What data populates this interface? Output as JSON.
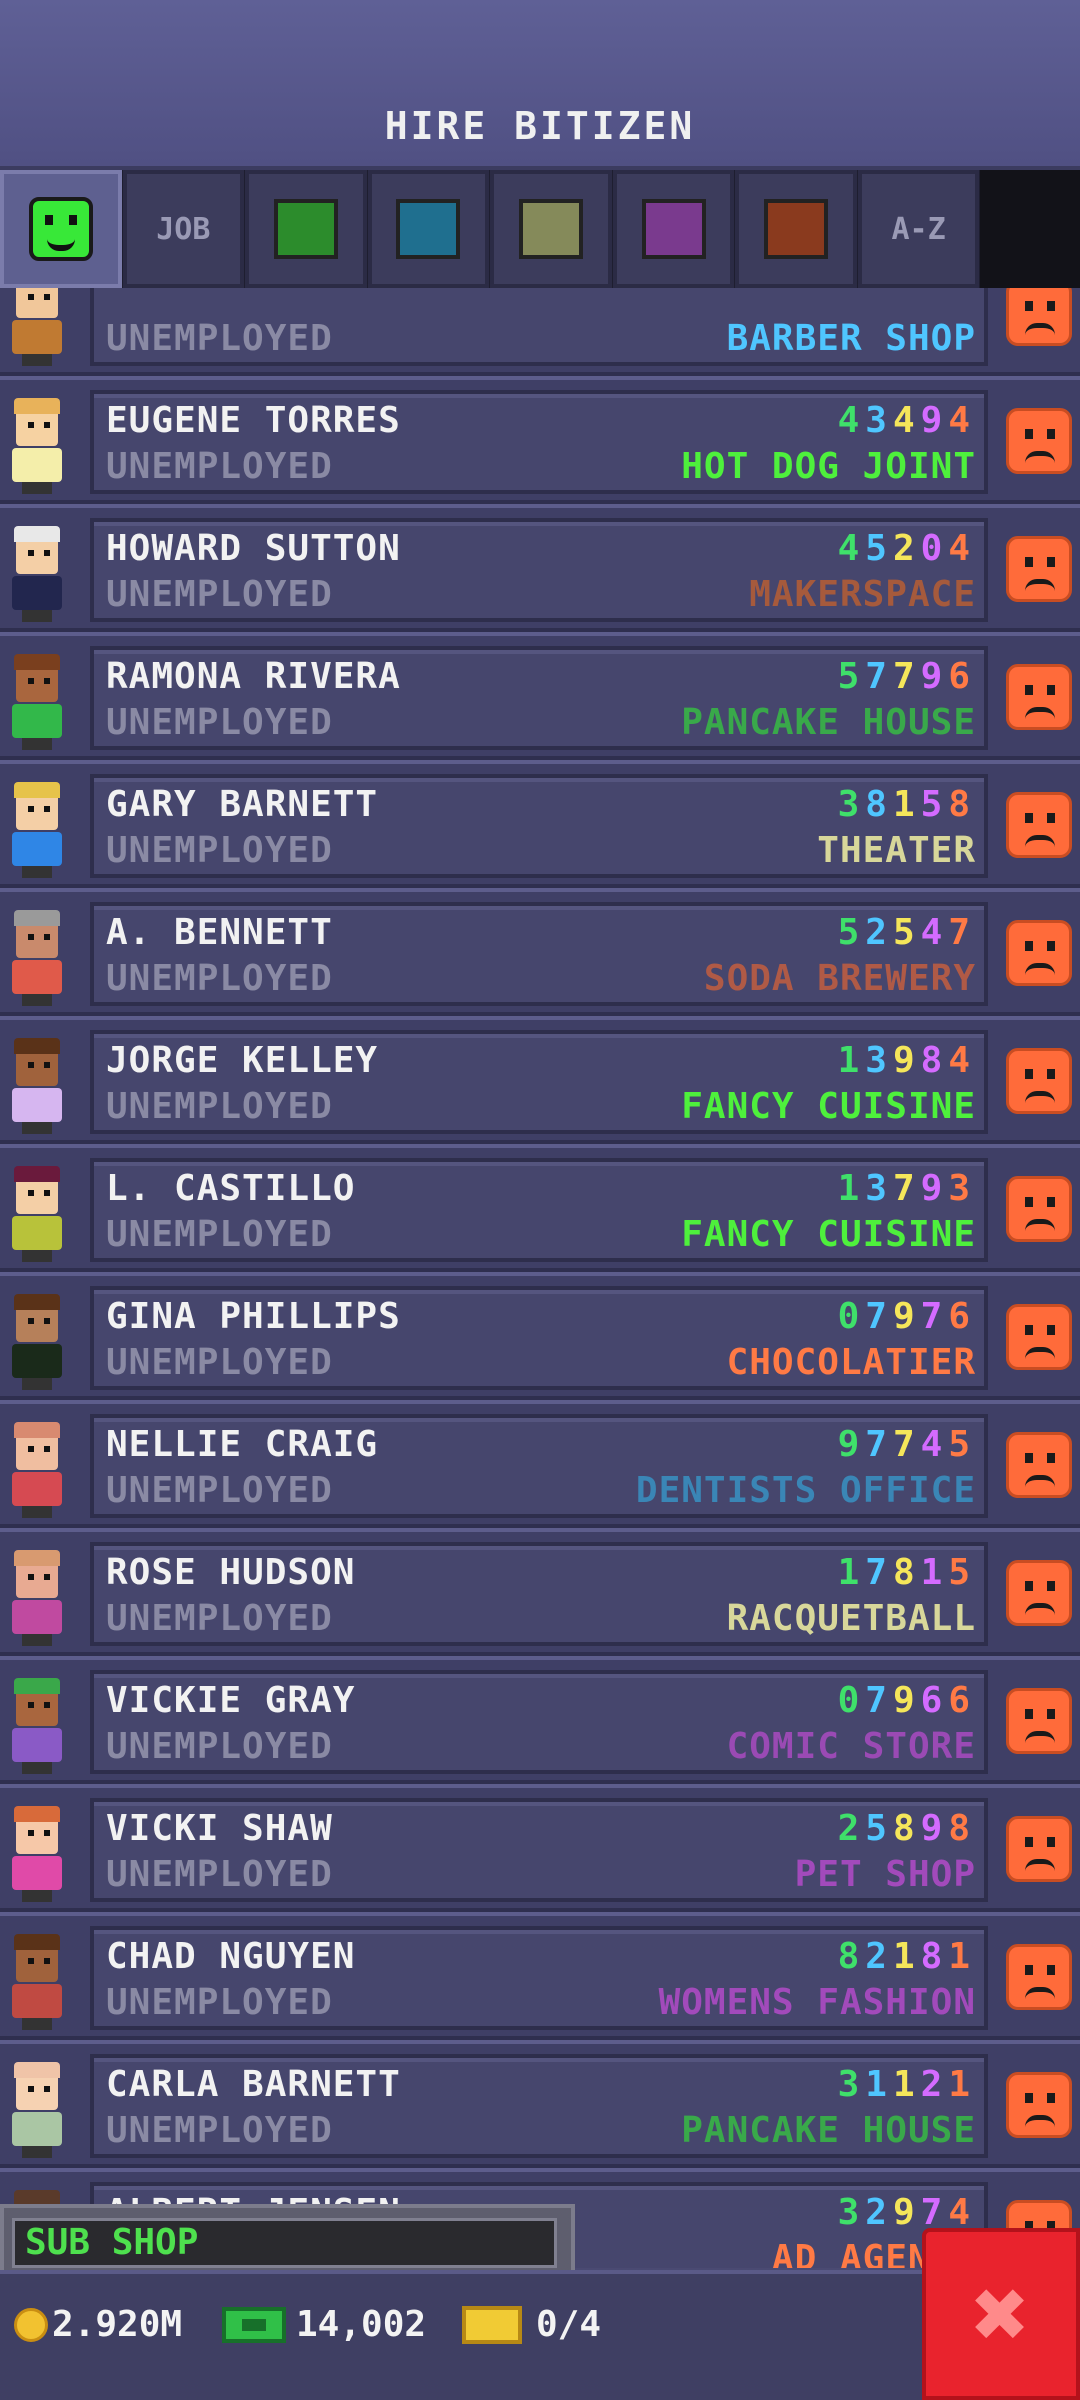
{
  "header": {
    "title": "HIRE BITIZEN"
  },
  "tabs": [
    {
      "id": "smile",
      "label": "",
      "color": "#38e838"
    },
    {
      "id": "job",
      "label": "JOB"
    },
    {
      "id": "green",
      "label": "",
      "color": "#2c8c2c"
    },
    {
      "id": "teal",
      "label": "",
      "color": "#1f6f8f"
    },
    {
      "id": "olive",
      "label": "",
      "color": "#858a5a"
    },
    {
      "id": "purple",
      "label": "",
      "color": "#7a3a8e"
    },
    {
      "id": "brown",
      "label": "",
      "color": "#8a3a1e"
    },
    {
      "id": "az",
      "label": "A-Z"
    }
  ],
  "bitizens": [
    {
      "name": "",
      "status": "UNEMPLOYED",
      "digits": [],
      "job": "BARBER SHOP",
      "job_color": "#4fc6ff",
      "skin": "#f1c79a",
      "hair": "#d6a14a",
      "shirt": "#c07a32"
    },
    {
      "name": "EUGENE TORRES",
      "status": "UNEMPLOYED",
      "digits": [
        "4",
        "3",
        "4",
        "9",
        "4"
      ],
      "job": "HOT DOG JOINT",
      "job_color": "#4ef03c",
      "skin": "#f6d2a2",
      "hair": "#e8b25a",
      "shirt": "#f4eeaa"
    },
    {
      "name": "HOWARD SUTTON",
      "status": "UNEMPLOYED",
      "digits": [
        "4",
        "5",
        "2",
        "0",
        "4"
      ],
      "job": "MAKERSPACE",
      "job_color": "#a65a3c",
      "skin": "#f4cfa6",
      "hair": "#e8e8e8",
      "shirt": "#22264e"
    },
    {
      "name": "RAMONA RIVERA",
      "status": "UNEMPLOYED",
      "digits": [
        "5",
        "7",
        "7",
        "9",
        "6"
      ],
      "job": "PANCAKE HOUSE",
      "job_color": "#39a94a",
      "skin": "#a9663e",
      "hair": "#7a3f1e",
      "shirt": "#32b84a"
    },
    {
      "name": "GARY BARNETT",
      "status": "UNEMPLOYED",
      "digits": [
        "3",
        "8",
        "1",
        "5",
        "8"
      ],
      "job": "THEATER",
      "job_color": "#d8d79a",
      "skin": "#f4cfa6",
      "hair": "#e6c34a",
      "shirt": "#2f86e6"
    },
    {
      "name": "A. BENNETT",
      "status": "UNEMPLOYED",
      "digits": [
        "5",
        "2",
        "5",
        "4",
        "7"
      ],
      "job": "SODA BREWERY",
      "job_color": "#b05a46",
      "skin": "#c98a6c",
      "hair": "#9a9a9a",
      "shirt": "#e05a4a"
    },
    {
      "name": "JORGE KELLEY",
      "status": "UNEMPLOYED",
      "digits": [
        "1",
        "3",
        "9",
        "8",
        "4"
      ],
      "job": "FANCY CUISINE",
      "job_color": "#4ef03c",
      "skin": "#a0623c",
      "hair": "#5a3218",
      "shirt": "#d6b6f0"
    },
    {
      "name": "L. CASTILLO",
      "status": "UNEMPLOYED",
      "digits": [
        "1",
        "3",
        "7",
        "9",
        "3"
      ],
      "job": "FANCY CUISINE",
      "job_color": "#4ef03c",
      "skin": "#f4cfa6",
      "hair": "#6a1a3c",
      "shirt": "#b8c23a"
    },
    {
      "name": "GINA PHILLIPS",
      "status": "UNEMPLOYED",
      "digits": [
        "0",
        "7",
        "9",
        "7",
        "6"
      ],
      "job": "CHOCOLATIER",
      "job_color": "#ff7a45",
      "skin": "#b6805a",
      "hair": "#5a3218",
      "shirt": "#1a2a1a"
    },
    {
      "name": "NELLIE CRAIG",
      "status": "UNEMPLOYED",
      "digits": [
        "9",
        "7",
        "7",
        "4",
        "5"
      ],
      "job": "DENTISTS OFFICE",
      "job_color": "#3a86b6",
      "skin": "#f0bea0",
      "hair": "#d88a70",
      "shirt": "#d64a52"
    },
    {
      "name": "ROSE HUDSON",
      "status": "UNEMPLOYED",
      "digits": [
        "1",
        "7",
        "8",
        "1",
        "5"
      ],
      "job": "RACQUETBALL",
      "job_color": "#d8d79a",
      "skin": "#e8aa92",
      "hair": "#d89a70",
      "shirt": "#c04aa0"
    },
    {
      "name": "VICKIE GRAY",
      "status": "UNEMPLOYED",
      "digits": [
        "0",
        "7",
        "9",
        "6",
        "6"
      ],
      "job": "COMIC STORE",
      "job_color": "#9a4ab4",
      "skin": "#a9663e",
      "hair": "#3aa84a",
      "shirt": "#8a5ac6"
    },
    {
      "name": "VICKI SHAW",
      "status": "UNEMPLOYED",
      "digits": [
        "2",
        "5",
        "8",
        "9",
        "8"
      ],
      "job": "PET SHOP",
      "job_color": "#a24abb",
      "skin": "#f6c8a8",
      "hair": "#d86a3a",
      "shirt": "#e04aa8"
    },
    {
      "name": "CHAD NGUYEN",
      "status": "UNEMPLOYED",
      "digits": [
        "8",
        "2",
        "1",
        "8",
        "1"
      ],
      "job": "WOMENS FASHION",
      "job_color": "#a24abb",
      "skin": "#a0623c",
      "hair": "#5a3218",
      "shirt": "#c04a42"
    },
    {
      "name": "CARLA BARNETT",
      "status": "UNEMPLOYED",
      "digits": [
        "3",
        "1",
        "1",
        "2",
        "1"
      ],
      "job": "PANCAKE HOUSE",
      "job_color": "#39a94a",
      "skin": "#f6d2b2",
      "hair": "#f0c4a8",
      "shirt": "#aac6a4"
    },
    {
      "name": "ALBERT JENSEN",
      "status": "",
      "digits": [
        "3",
        "2",
        "9",
        "7",
        "4"
      ],
      "job": "AD AGENCY",
      "job_color": "#ff7a45",
      "skin": "#f4cfa6",
      "hair": "#5a3a2a",
      "shirt": "#7a7a9a"
    }
  ],
  "subshop": {
    "label": "SUB SHOP"
  },
  "bottom": {
    "coins": "2.920M",
    "bux": "14,002",
    "tickets": "0/4"
  },
  "close": {
    "label": "✖"
  }
}
